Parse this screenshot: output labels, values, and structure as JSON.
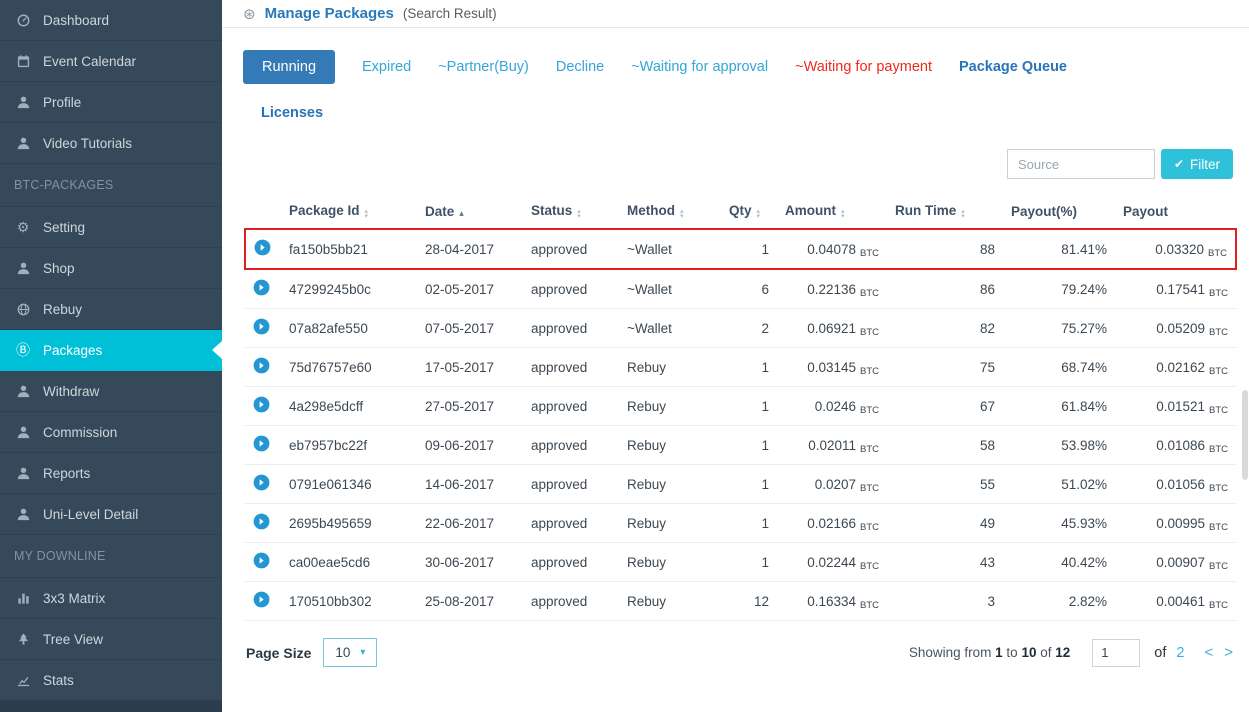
{
  "colors": {
    "sidebar_bg": "#36495a",
    "sidebar_border": "#2e4152",
    "sidebar_active": "#00c0d8",
    "tab_active": "#337ab7",
    "link": "#35a6d8",
    "link_bold": "#2a74b8",
    "danger": "#ee2a1f",
    "title": "#2a7ab9",
    "filter_button": "#2ec1d9",
    "row_icon": "#2496d2",
    "annotation": "#e01f1f",
    "pagination": "#3bafda"
  },
  "sidebar": {
    "sections": [
      {
        "header": null,
        "items": [
          {
            "label": "Dashboard",
            "icon": "gauge-icon"
          },
          {
            "label": "Event Calendar",
            "icon": "calendar-icon"
          },
          {
            "label": "Profile",
            "icon": "user-icon"
          },
          {
            "label": "Video Tutorials",
            "icon": "user-icon"
          }
        ]
      },
      {
        "header": "BTC-PACKAGES",
        "items": [
          {
            "label": "Setting",
            "icon": "gear-icon"
          },
          {
            "label": "Shop",
            "icon": "user-icon"
          },
          {
            "label": "Rebuy",
            "icon": "globe-icon"
          },
          {
            "label": "Packages",
            "icon": "coin-icon",
            "active": true
          },
          {
            "label": "Withdraw",
            "icon": "user-icon"
          },
          {
            "label": "Commission",
            "icon": "user-icon"
          },
          {
            "label": "Reports",
            "icon": "user-icon"
          },
          {
            "label": "Uni-Level Detail",
            "icon": "user-icon"
          }
        ]
      },
      {
        "header": "MY DOWNLINE",
        "items": [
          {
            "label": "3x3 Matrix",
            "icon": "bars-icon"
          },
          {
            "label": "Tree View",
            "icon": "tree-icon"
          },
          {
            "label": "Stats",
            "icon": "chart-icon"
          }
        ]
      }
    ]
  },
  "header": {
    "title": "Manage Packages",
    "subtitle": "(Search Result)"
  },
  "tabs": {
    "row1": [
      {
        "label": "Running",
        "state": "active"
      },
      {
        "label": "Expired",
        "state": "link"
      },
      {
        "label": "~Partner(Buy)",
        "state": "link"
      },
      {
        "label": "Decline",
        "state": "link"
      },
      {
        "label": "~Waiting for approval",
        "state": "link"
      },
      {
        "label": "~Waiting for payment",
        "state": "danger"
      },
      {
        "label": "Package Queue",
        "state": "bold"
      }
    ],
    "row2": [
      {
        "label": "Licenses",
        "state": "bold"
      }
    ]
  },
  "filter": {
    "source_placeholder": "Source",
    "button_label": "Filter"
  },
  "table": {
    "columns": [
      {
        "label": "Package Id",
        "sort": "both"
      },
      {
        "label": "Date",
        "sort": "asc"
      },
      {
        "label": "Status",
        "sort": "both"
      },
      {
        "label": "Method",
        "sort": "both"
      },
      {
        "label": "Qty",
        "sort": "both"
      },
      {
        "label": "Amount",
        "sort": "both"
      },
      {
        "label": "Run Time",
        "sort": "both"
      },
      {
        "label": "Payout(%)",
        "sort": "none"
      },
      {
        "label": "Payout",
        "sort": "none"
      }
    ],
    "rows": [
      {
        "package_id": "fa150b5bb21",
        "date": "28-04-2017",
        "status": "approved",
        "method": "~Wallet",
        "qty": "1",
        "amount": "0.04078",
        "amount_unit": "BTC",
        "run_time": "88",
        "payout_pct": "81.41%",
        "payout": "0.03320",
        "payout_unit": "BTC",
        "highlighted": true
      },
      {
        "package_id": "47299245b0c",
        "date": "02-05-2017",
        "status": "approved",
        "method": "~Wallet",
        "qty": "6",
        "amount": "0.22136",
        "amount_unit": "BTC",
        "run_time": "86",
        "payout_pct": "79.24%",
        "payout": "0.17541",
        "payout_unit": "BTC"
      },
      {
        "package_id": "07a82afe550",
        "date": "07-05-2017",
        "status": "approved",
        "method": "~Wallet",
        "qty": "2",
        "amount": "0.06921",
        "amount_unit": "BTC",
        "run_time": "82",
        "payout_pct": "75.27%",
        "payout": "0.05209",
        "payout_unit": "BTC"
      },
      {
        "package_id": "75d76757e60",
        "date": "17-05-2017",
        "status": "approved",
        "method": "Rebuy",
        "qty": "1",
        "amount": "0.03145",
        "amount_unit": "BTC",
        "run_time": "75",
        "payout_pct": "68.74%",
        "payout": "0.02162",
        "payout_unit": "BTC"
      },
      {
        "package_id": "4a298e5dcff",
        "date": "27-05-2017",
        "status": "approved",
        "method": "Rebuy",
        "qty": "1",
        "amount": "0.0246",
        "amount_unit": "BTC",
        "run_time": "67",
        "payout_pct": "61.84%",
        "payout": "0.01521",
        "payout_unit": "BTC"
      },
      {
        "package_id": "eb7957bc22f",
        "date": "09-06-2017",
        "status": "approved",
        "method": "Rebuy",
        "qty": "1",
        "amount": "0.02011",
        "amount_unit": "BTC",
        "run_time": "58",
        "payout_pct": "53.98%",
        "payout": "0.01086",
        "payout_unit": "BTC"
      },
      {
        "package_id": "0791e061346",
        "date": "14-06-2017",
        "status": "approved",
        "method": "Rebuy",
        "qty": "1",
        "amount": "0.0207",
        "amount_unit": "BTC",
        "run_time": "55",
        "payout_pct": "51.02%",
        "payout": "0.01056",
        "payout_unit": "BTC"
      },
      {
        "package_id": "2695b495659",
        "date": "22-06-2017",
        "status": "approved",
        "method": "Rebuy",
        "qty": "1",
        "amount": "0.02166",
        "amount_unit": "BTC",
        "run_time": "49",
        "payout_pct": "45.93%",
        "payout": "0.00995",
        "payout_unit": "BTC"
      },
      {
        "package_id": "ca00eae5cd6",
        "date": "30-06-2017",
        "status": "approved",
        "method": "Rebuy",
        "qty": "1",
        "amount": "0.02244",
        "amount_unit": "BTC",
        "run_time": "43",
        "payout_pct": "40.42%",
        "payout": "0.00907",
        "payout_unit": "BTC"
      },
      {
        "package_id": "170510bb302",
        "date": "25-08-2017",
        "status": "approved",
        "method": "Rebuy",
        "qty": "12",
        "amount": "0.16334",
        "amount_unit": "BTC",
        "run_time": "3",
        "payout_pct": "2.82%",
        "payout": "0.00461",
        "payout_unit": "BTC"
      }
    ]
  },
  "footer": {
    "page_size_label": "Page Size",
    "page_size_value": "10",
    "showing": {
      "prefix": "Showing from",
      "from": "1",
      "to_word": "to",
      "to": "10",
      "of_word": "of",
      "total": "12"
    },
    "page_input_value": "1",
    "of_label": "of",
    "total_pages": "2"
  }
}
